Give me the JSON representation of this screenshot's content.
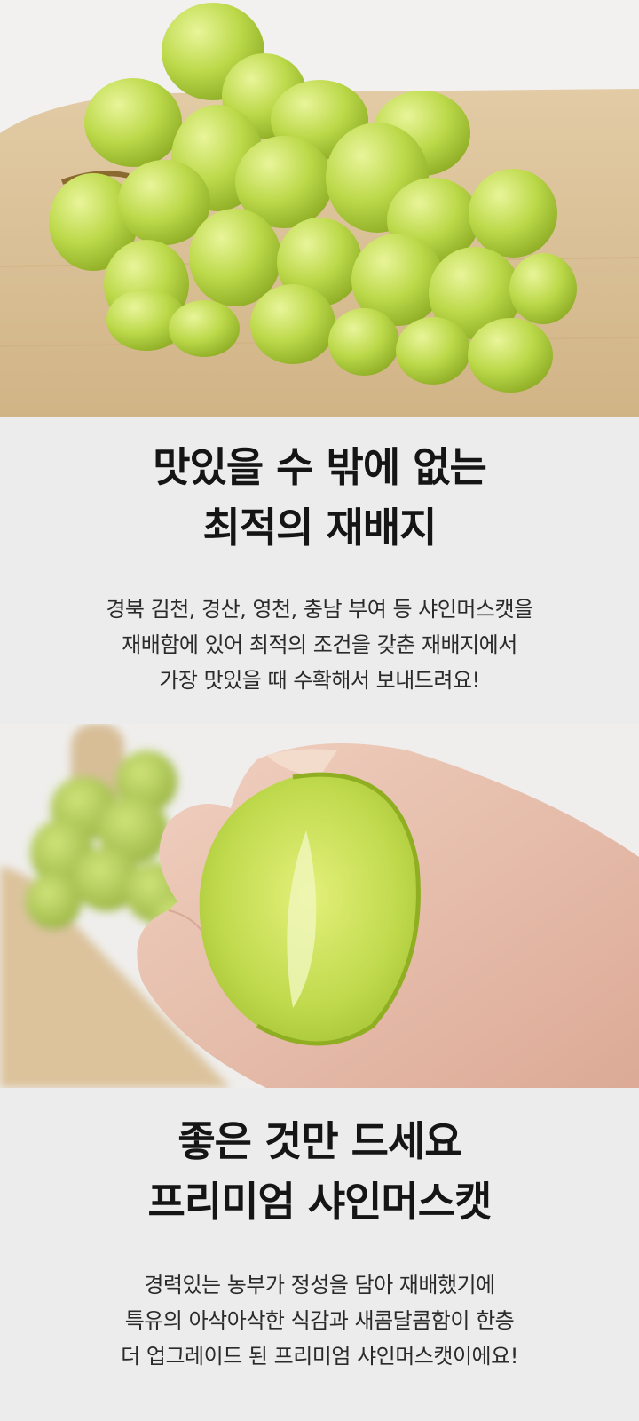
{
  "section1": {
    "headline": [
      "맛있을 수 밖에 없는",
      "최적의 재배지"
    ],
    "body": [
      "경북 김천, 경산, 영천, 충남 부여 등 샤인머스캣을",
      "재배함에 있어 최적의 조건을 갖춘 재배지에서",
      "가장 맛있을 때 수확해서 보내드려요!"
    ]
  },
  "section2": {
    "headline": [
      "좋은 것만 드세요",
      "프리미엄 샤인머스캣"
    ],
    "body": [
      "경력있는 농부가 정성을 담아 재배했기에",
      "특유의 아삭아삭한 식감과 새콤달콤함이 한층",
      "더 업그레이드 된 프리미엄 샤인머스캣이에요!"
    ]
  },
  "colors": {
    "background": "#ececec",
    "grape_green": "#b9d94a",
    "board_wood": "#d9bf96"
  }
}
